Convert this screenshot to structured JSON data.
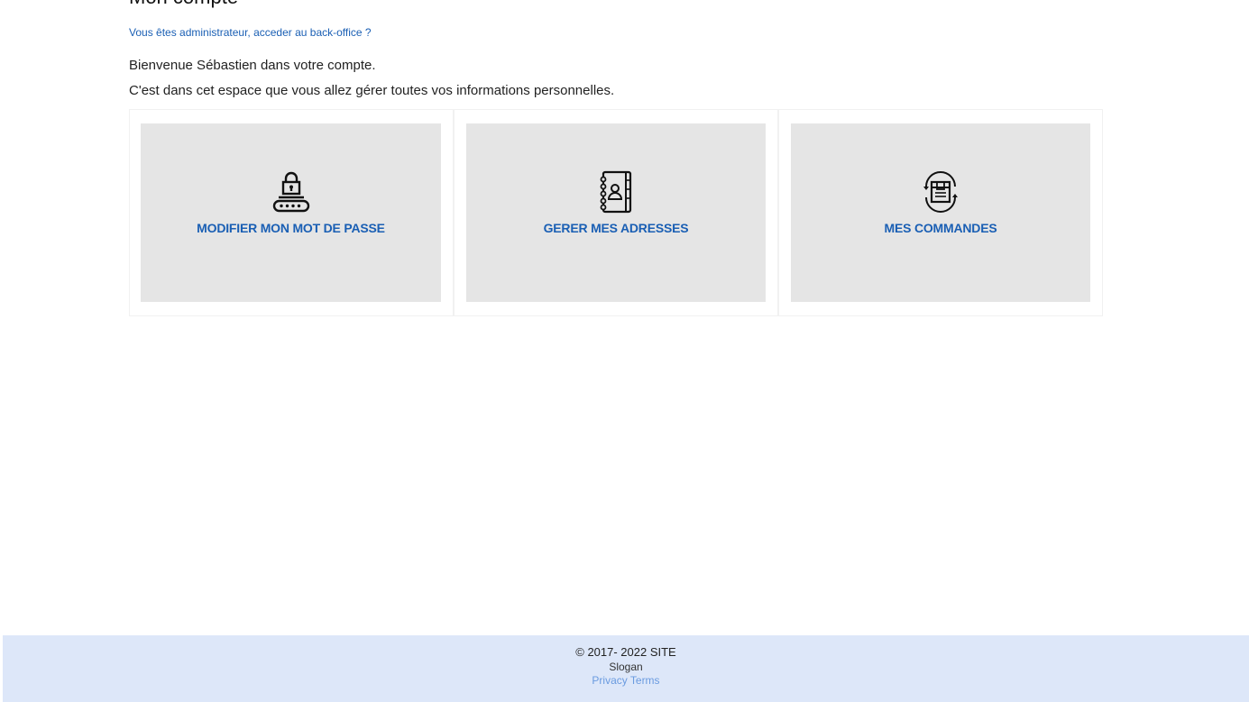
{
  "header": {
    "title": "Mon compte",
    "admin_link": "Vous êtes administrateur, acceder au back-office ?"
  },
  "main": {
    "welcome": "Bienvenue Sébastien dans votre compte.",
    "intro": "C'est dans cet espace que vous allez gérer toutes vos informations personnelles.",
    "cards": [
      {
        "label": "MODIFIER MON MOT DE PASSE",
        "icon": "lock-password-icon"
      },
      {
        "label": "GERER MES ADRESSES",
        "icon": "address-book-icon"
      },
      {
        "label": "MES COMMANDES",
        "icon": "orders-box-icon"
      }
    ]
  },
  "footer": {
    "copyright": "© 2017-  2022 SITE",
    "slogan": "Slogan",
    "privacy": "Privacy",
    "terms": "Terms"
  },
  "colors": {
    "accent": "#1a5fb4",
    "card_bg": "#e5e5e5",
    "footer_bg": "#dde7f9",
    "footer_link": "#6a9be0"
  }
}
